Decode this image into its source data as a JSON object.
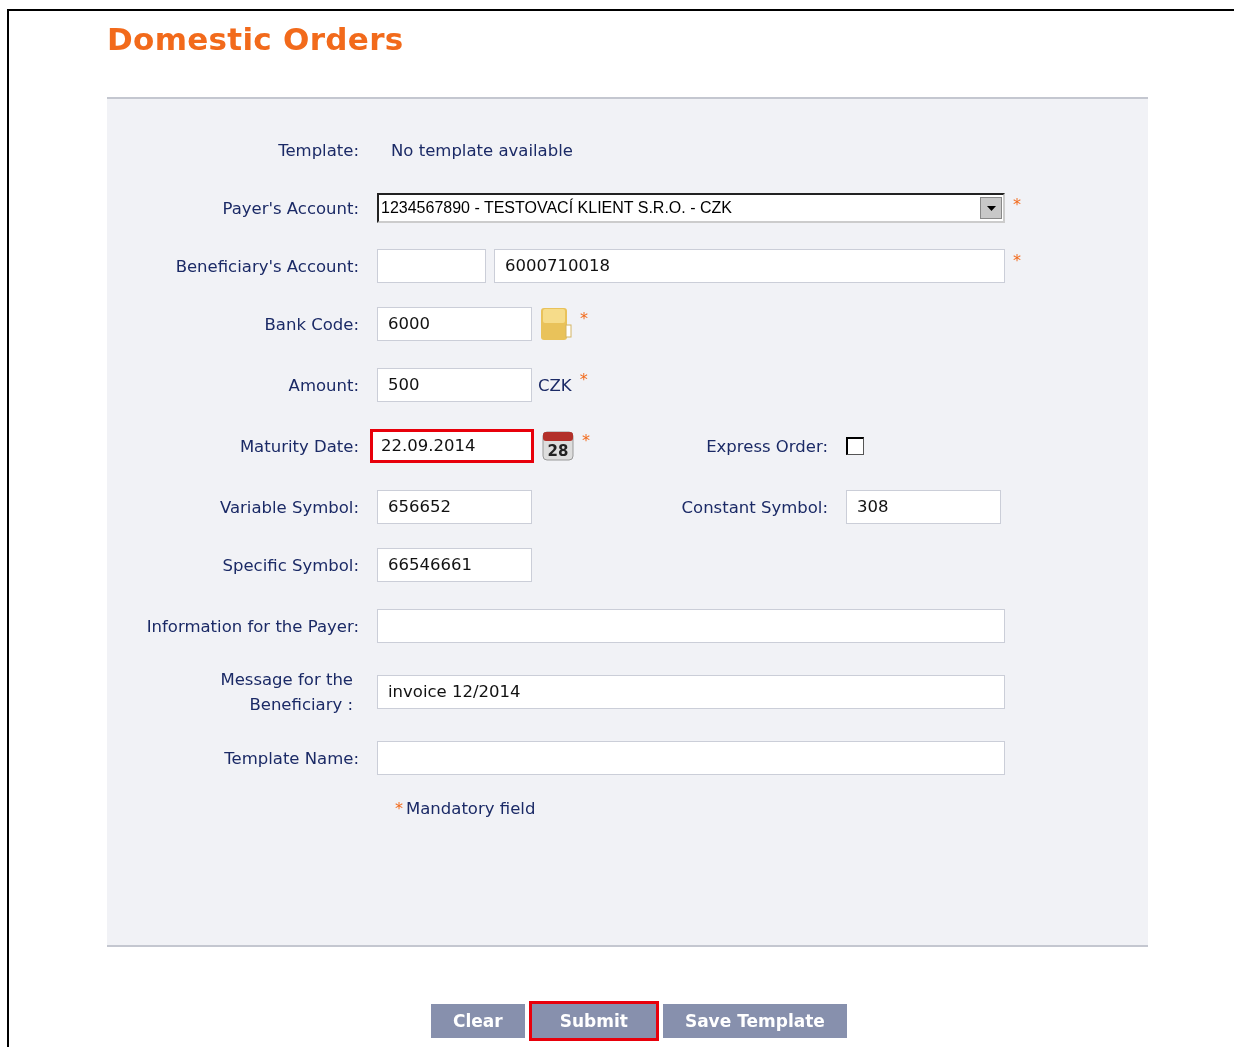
{
  "title": "Domestic Orders",
  "rows": [
    {
      "label": "Template:",
      "kind": "text",
      "value": "No template available"
    },
    {
      "label": "Payer's Account:",
      "kind": "select",
      "value": "1234567890 - TESTOVACÍ KLIENT S.R.O. - CZK",
      "required_mark": "*"
    },
    {
      "label": "Beneficiary's Account:",
      "kind": "account",
      "value": "6000710018",
      "required_mark": "*"
    },
    {
      "label": "Bank Code:",
      "kind": "bank",
      "value": "6000",
      "required_mark": "*"
    },
    {
      "label": "Amount:",
      "kind": "amount",
      "value": "500",
      "currency": "CZK",
      "required_mark": "*"
    },
    {
      "label": "Maturity Date:",
      "kind": "date",
      "value": "22.09.2014",
      "highlighted": true,
      "calendar_day": "28",
      "required_mark": "*",
      "side": {
        "label": "Express Order:",
        "kind": "checkbox",
        "checked": false
      }
    },
    {
      "label": "Variable Symbol:",
      "kind": "short",
      "value": "656652",
      "side": {
        "label": "Constant Symbol:",
        "kind": "short",
        "value": "308"
      }
    },
    {
      "label": "Specific Symbol:",
      "kind": "short",
      "value": "66546661"
    },
    {
      "label": "Information for the Payer:",
      "kind": "wide"
    },
    {
      "label": "Message for the Beneficiary :",
      "kind": "wide",
      "value": "invoice 12/2014"
    },
    {
      "label": "Template Name:",
      "kind": "wide"
    }
  ],
  "note": {
    "mark": "*",
    "text": "Mandatory field"
  },
  "buttons": [
    {
      "label": "Clear",
      "highlighted": false
    },
    {
      "label": "Submit",
      "highlighted": true
    },
    {
      "label": "Save Template",
      "highlighted": false
    }
  ]
}
